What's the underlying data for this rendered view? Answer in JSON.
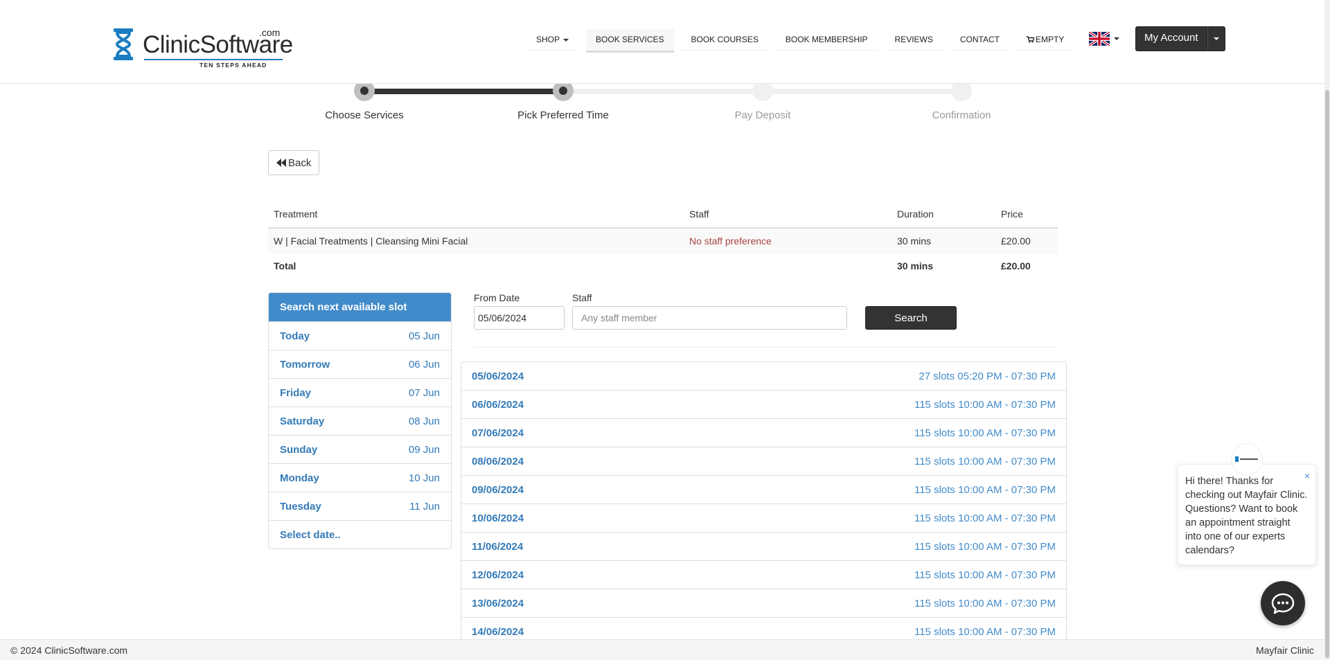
{
  "header": {
    "logo": {
      "dotcom": ".com",
      "brand": "ClinicSoftware",
      "tagline": "TEN STEPS AHEAD"
    },
    "nav": [
      {
        "label": "SHOP",
        "has_caret": true
      },
      {
        "label": "BOOK SERVICES",
        "active": true
      },
      {
        "label": "BOOK COURSES"
      },
      {
        "label": "BOOK MEMBERSHIP"
      },
      {
        "label": "REVIEWS"
      },
      {
        "label": "CONTACT"
      },
      {
        "label": "EMPTY",
        "icon": "cart-icon"
      }
    ],
    "language_icon": "uk-flag-icon",
    "account_label": "My Account"
  },
  "steps": [
    {
      "label": "Choose Services",
      "status": "done"
    },
    {
      "label": "Pick Preferred Time",
      "status": "done"
    },
    {
      "label": "Pay Deposit",
      "status": "todo"
    },
    {
      "label": "Confirmation",
      "status": "todo"
    }
  ],
  "back_label": "Back",
  "treatment_table": {
    "headers": {
      "treatment": "Treatment",
      "staff": "Staff",
      "duration": "Duration",
      "price": "Price"
    },
    "rows": [
      {
        "treatment": "W | Facial Treatments | Cleansing Mini Facial",
        "staff": "No staff preference",
        "duration": "30 mins",
        "price": "£20.00"
      }
    ],
    "total": {
      "label": "Total",
      "duration": "30 mins",
      "price": "£20.00"
    }
  },
  "slot_panel": {
    "heading": "Search next available slot",
    "items": [
      {
        "day": "Today",
        "date": "05 Jun"
      },
      {
        "day": "Tomorrow",
        "date": "06 Jun"
      },
      {
        "day": "Friday",
        "date": "07 Jun"
      },
      {
        "day": "Saturday",
        "date": "08 Jun"
      },
      {
        "day": "Sunday",
        "date": "09 Jun"
      },
      {
        "day": "Monday",
        "date": "10 Jun"
      },
      {
        "day": "Tuesday",
        "date": "11 Jun"
      },
      {
        "day": "Select date..",
        "date": ""
      }
    ]
  },
  "search": {
    "from_date_label": "From Date",
    "from_date_value": "05/06/2024",
    "staff_label": "Staff",
    "staff_placeholder": "Any staff member",
    "button_label": "Search"
  },
  "availability": [
    {
      "date": "05/06/2024",
      "slots": "27 slots 05:20 PM - 07:30 PM"
    },
    {
      "date": "06/06/2024",
      "slots": "115 slots 10:00 AM - 07:30 PM"
    },
    {
      "date": "07/06/2024",
      "slots": "115 slots 10:00 AM - 07:30 PM"
    },
    {
      "date": "08/06/2024",
      "slots": "115 slots 10:00 AM - 07:30 PM"
    },
    {
      "date": "09/06/2024",
      "slots": "115 slots 10:00 AM - 07:30 PM"
    },
    {
      "date": "10/06/2024",
      "slots": "115 slots 10:00 AM - 07:30 PM"
    },
    {
      "date": "11/06/2024",
      "slots": "115 slots 10:00 AM - 07:30 PM"
    },
    {
      "date": "12/06/2024",
      "slots": "115 slots 10:00 AM - 07:30 PM"
    },
    {
      "date": "13/06/2024",
      "slots": "115 slots 10:00 AM - 07:30 PM"
    },
    {
      "date": "14/06/2024",
      "slots": "115 slots 10:00 AM - 07:30 PM"
    }
  ],
  "chat": {
    "message": "Hi there! Thanks for checking out Mayfair Clinic. Questions? Want to book an appointment straight into one of our experts calendars?",
    "close_symbol": "×",
    "launcher_icon": "chat-bubble-icon"
  },
  "footer": {
    "left": "© 2024 ClinicSoftware.com",
    "right": "Mayfair Clinic"
  },
  "colors": {
    "primary": "#337ab7",
    "panel_heading": "#428bca",
    "dark_button": "#333333",
    "staff_pref": "#a94442"
  }
}
